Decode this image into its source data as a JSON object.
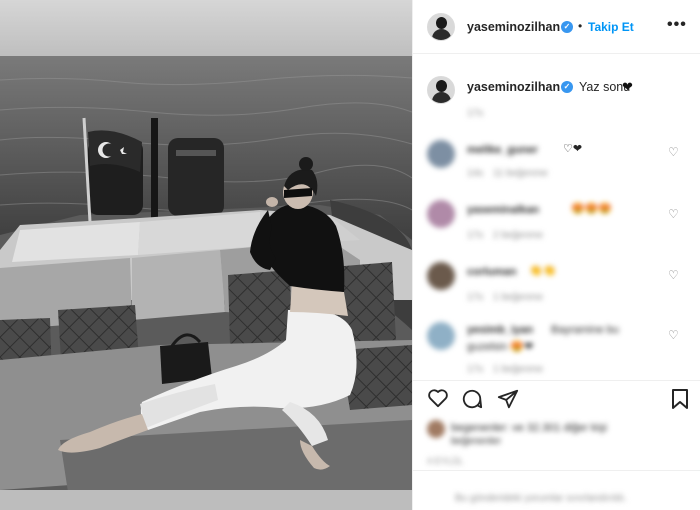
{
  "post": {
    "username": "yaseminozilhan",
    "follow_label": "Takip Et",
    "more_label": "•••",
    "caption": "Yaz sonu",
    "caption_emoji": "❤",
    "time_ago": "17s"
  },
  "comments": [
    {
      "name": "melike_guner",
      "text": "♡❤",
      "time": "14s",
      "likes": "11 beğenme"
    },
    {
      "name": "yaseminalkan",
      "text": "😍😍😍",
      "time": "17s",
      "likes": "2 beğenme"
    },
    {
      "name": "corluman",
      "text": "👏👏",
      "time": "17s",
      "likes": "1 beğenme"
    },
    {
      "name": "yesimb_iyan",
      "text": "Bayramine bu",
      "text2": "guzelsin 😍❤",
      "time": "17s",
      "likes": "1 beğenme"
    }
  ],
  "likes_summary": {
    "text": "begenenler: ve 32.301 diğer kişi",
    "sub": "beğenenler",
    "date": "4 EYLÜL"
  },
  "footer": {
    "text": "Bu gönderideki yorumlar sınırlandırıldı."
  },
  "icons": {
    "verified": "verified-badge-icon",
    "heart": "heart-icon",
    "comment": "comment-icon",
    "share": "share-icon",
    "save": "bookmark-icon",
    "flag": "turkish-flag"
  },
  "colors": {
    "accent": "#0095f6",
    "verified": "#3897f0",
    "text": "#262626",
    "muted": "#8e8e8e"
  }
}
